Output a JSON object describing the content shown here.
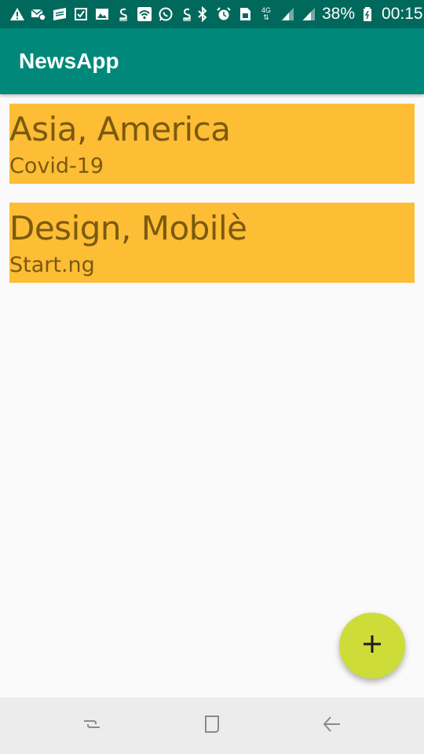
{
  "status_bar": {
    "left_icons": [
      "warning-icon",
      "email-settings-icon",
      "news-icon",
      "checkbox-icon",
      "gallery-icon",
      "money-icon",
      "wifi-icon",
      "whatsapp-icon",
      "money-icon-2"
    ],
    "network_label": "4G",
    "battery": "38%",
    "time": "00:15"
  },
  "app_bar": {
    "title": "NewsApp"
  },
  "news": {
    "items": [
      {
        "title": "Asia, America",
        "subtitle": "Covid-19"
      },
      {
        "title": "Design, Mobilè",
        "subtitle": "Start.ng"
      }
    ]
  },
  "fab": {
    "icon": "plus-icon"
  },
  "nav_bar": {
    "buttons": [
      "recents-icon",
      "home-icon",
      "back-icon"
    ]
  },
  "colors": {
    "status_bar": "#00695c",
    "app_bar": "#00897b",
    "card_background": "#fdbd35",
    "card_text": "#7b5a0e",
    "fab": "#cddc39",
    "background": "#fafafa",
    "nav_bar": "#ececec"
  }
}
